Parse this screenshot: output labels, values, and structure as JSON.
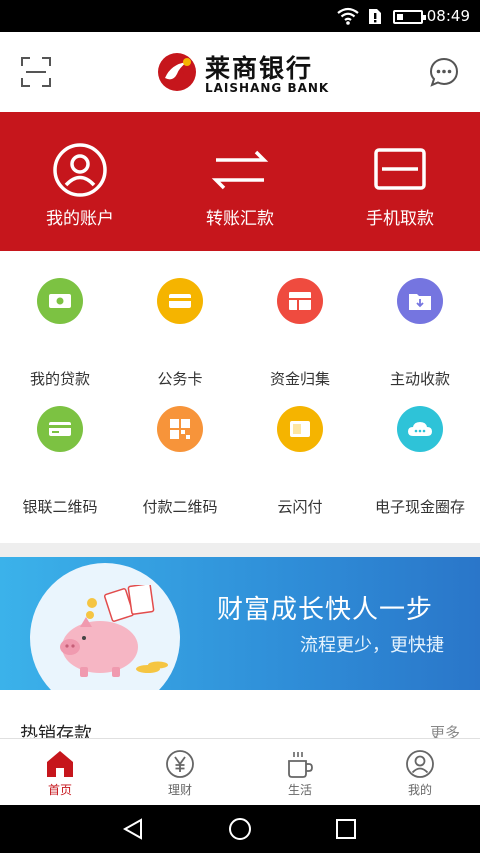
{
  "status_bar": {
    "time": "08:49"
  },
  "header": {
    "logo_cn": "莱商银行",
    "logo_en": "LAISHANG BANK"
  },
  "quick_actions": [
    {
      "label": "我的账户",
      "icon": "user-account-icon"
    },
    {
      "label": "转账汇款",
      "icon": "transfer-arrows-icon"
    },
    {
      "label": "手机取款",
      "icon": "card-withdraw-icon"
    }
  ],
  "services": [
    {
      "label": "我的贷款",
      "icon": "loan-icon",
      "color": "#7cc242"
    },
    {
      "label": "公务卡",
      "icon": "official-card-icon",
      "color": "#f5b400"
    },
    {
      "label": "资金归集",
      "icon": "fund-collect-icon",
      "color": "#ef4b3f"
    },
    {
      "label": "主动收款",
      "icon": "receive-payment-icon",
      "color": "#7575e0"
    },
    {
      "label": "银联二维码",
      "icon": "unionpay-qr-icon",
      "color": "#7cc242"
    },
    {
      "label": "付款二维码",
      "icon": "payment-qr-icon",
      "color": "#f7943a"
    },
    {
      "label": "云闪付",
      "icon": "cloud-quickpass-icon",
      "color": "#f5b400"
    },
    {
      "label": "电子现金圈存",
      "icon": "e-cash-cloud-icon",
      "color": "#2ec3d8"
    }
  ],
  "banner": {
    "title": "财富成长快人一步",
    "subtitle": "流程更少，更快捷"
  },
  "hot_section": {
    "title": "热销存款",
    "more": "更多"
  },
  "tabs": [
    {
      "label": "首页",
      "icon": "home-icon",
      "active": true
    },
    {
      "label": "理财",
      "icon": "yen-icon",
      "active": false
    },
    {
      "label": "生活",
      "icon": "coffee-cup-icon",
      "active": false
    },
    {
      "label": "我的",
      "icon": "profile-icon",
      "active": false
    }
  ],
  "colors": {
    "brand_red": "#c6161c",
    "banner_blue": "#2f8ed8"
  }
}
